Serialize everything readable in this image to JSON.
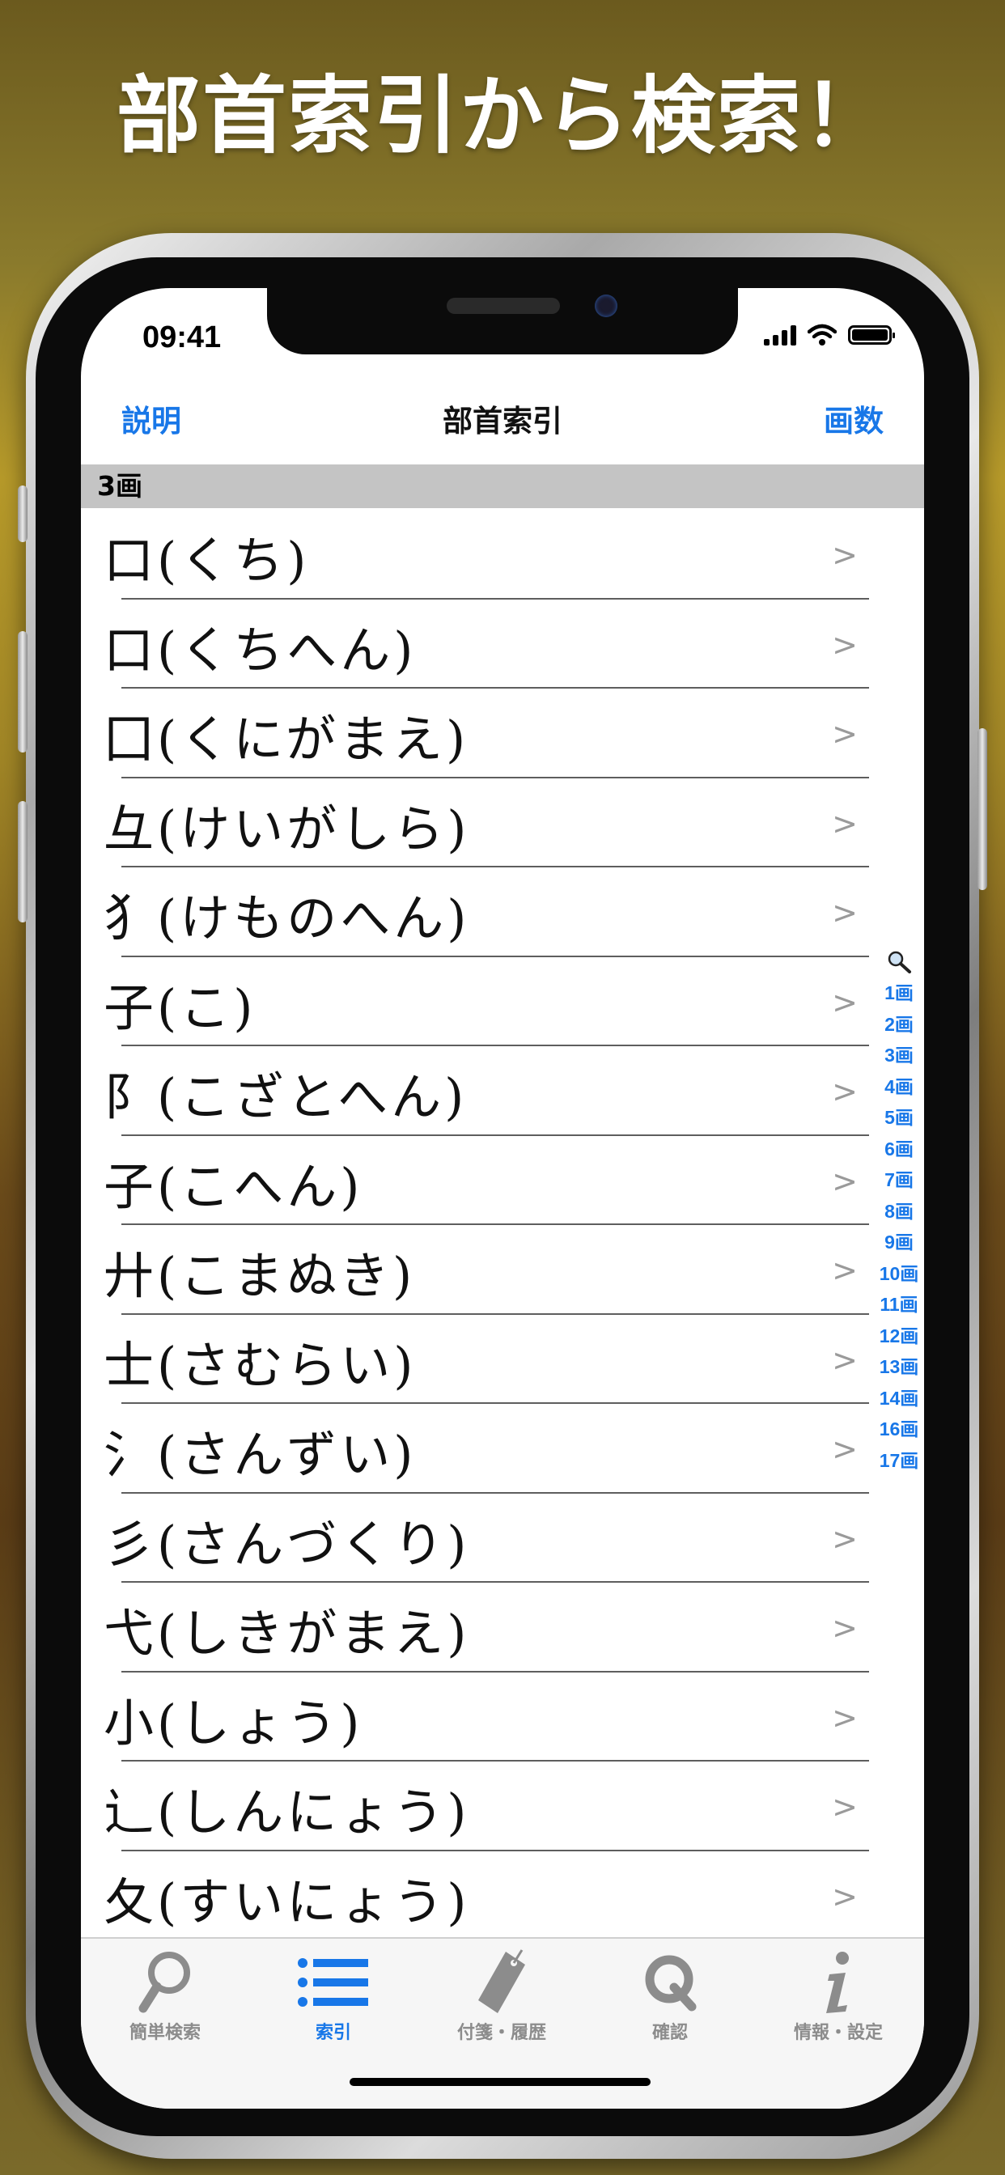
{
  "headline": "部首索引から検索！",
  "status": {
    "time": "09:41"
  },
  "nav": {
    "left": "説明",
    "title": "部首索引",
    "right": "画数"
  },
  "section_header": "3画",
  "rows": [
    "口(くち)",
    "口(くちへん)",
    "囗(くにがまえ)",
    "彑(けいがしら)",
    "犭(けものへん)",
    "子(こ)",
    "阝(こざとへん)",
    "子(こへん)",
    "廾(こまぬき)",
    "士(さむらい)",
    "氵(さんずい)",
    "彡(さんづくり)",
    "弋(しきがまえ)",
    "小(しょう)",
    "辶(しんにょう)",
    "夂(すいにょう)"
  ],
  "chevron": ">",
  "index": [
    "1画",
    "2画",
    "3画",
    "4画",
    "5画",
    "6画",
    "7画",
    "8画",
    "9画",
    "10画",
    "11画",
    "12画",
    "13画",
    "14画",
    "16画",
    "17画"
  ],
  "tabs": [
    {
      "label": "簡単検索",
      "icon": "magnifier-icon"
    },
    {
      "label": "索引",
      "icon": "list-icon"
    },
    {
      "label": "付箋・履歴",
      "icon": "bookmark-tag-icon"
    },
    {
      "label": "確認",
      "icon": "q-icon"
    },
    {
      "label": "情報・設定",
      "icon": "info-icon"
    }
  ],
  "active_tab": 1,
  "colors": {
    "accent": "#1877e8",
    "section_bg": "#c4c4c4",
    "inactive": "#8c8c8c"
  }
}
